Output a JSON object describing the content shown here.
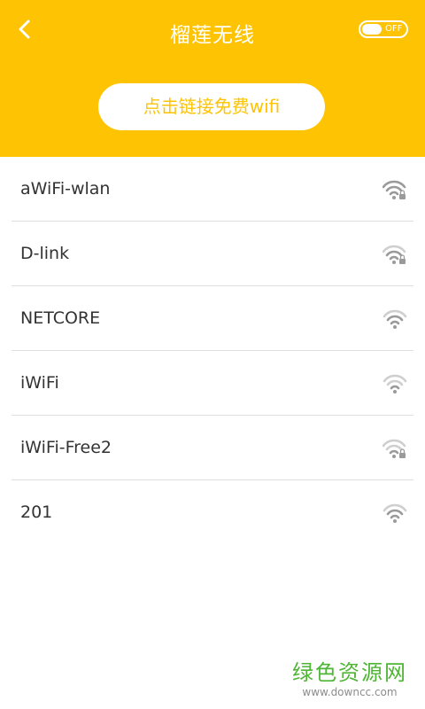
{
  "header": {
    "title": "榴莲无线",
    "toggle_label": "OFF",
    "connect_label": "点击链接免费wifi",
    "background": "#fec403"
  },
  "networks": [
    {
      "name": "aWiFi-wlan",
      "locked": true,
      "signal": "strong"
    },
    {
      "name": "D-link",
      "locked": true,
      "signal": "medium"
    },
    {
      "name": "NETCORE",
      "locked": false,
      "signal": "medium"
    },
    {
      "name": "iWiFi",
      "locked": false,
      "signal": "weak"
    },
    {
      "name": "iWiFi-Free2",
      "locked": true,
      "signal": "weak"
    },
    {
      "name": "201",
      "locked": false,
      "signal": "medium"
    }
  ],
  "icons": {
    "back": "chevron-left-icon",
    "wifi_locked": "wifi-lock-icon",
    "wifi": "wifi-icon"
  },
  "watermark": {
    "title": "绿色资源网",
    "url": "www.downcc.com"
  }
}
